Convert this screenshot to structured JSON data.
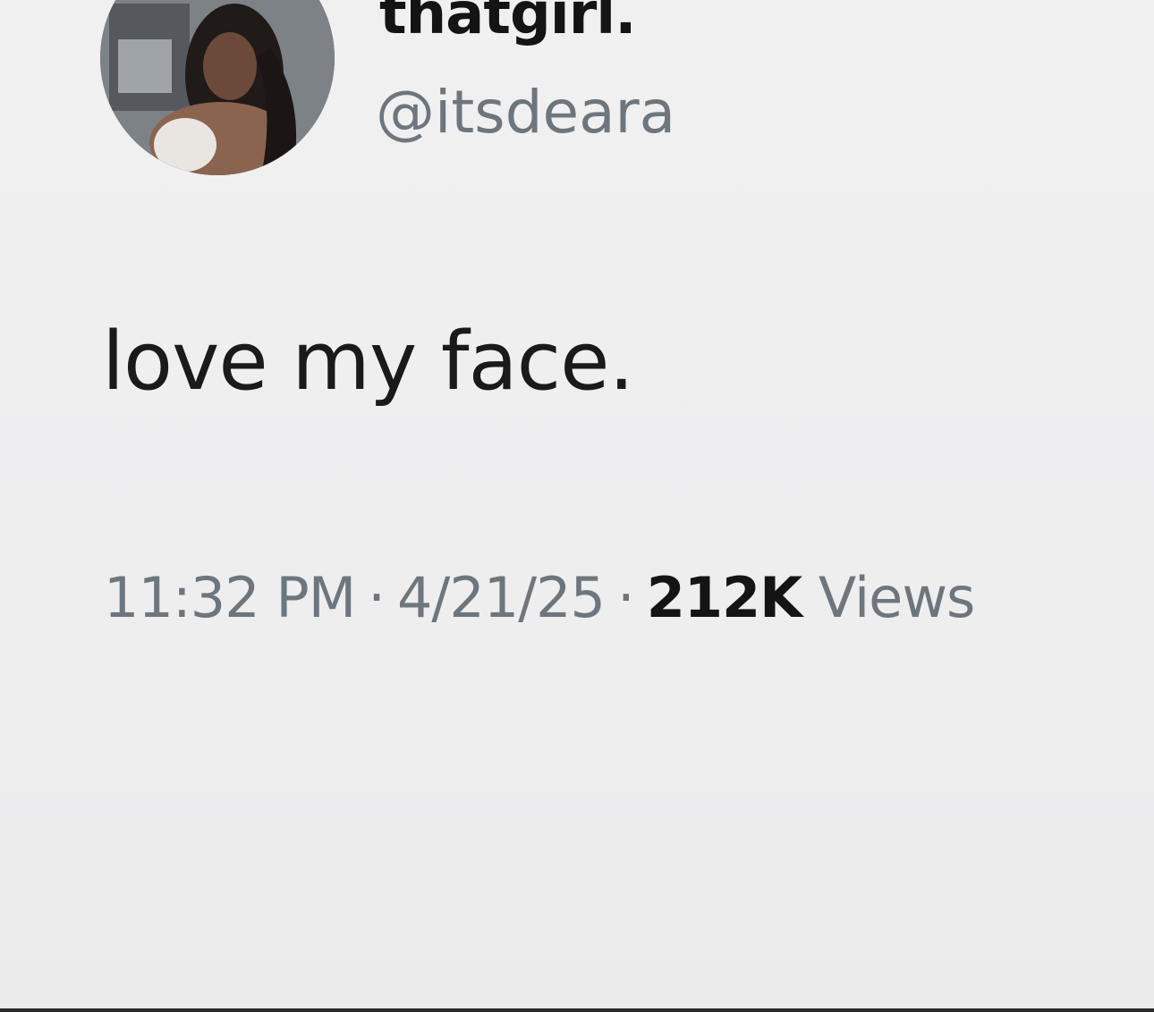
{
  "tweet": {
    "display_name": "thatgirl.",
    "handle": "@itsdeara",
    "text": "love my face.",
    "time": "11:32 PM",
    "date": "4/21/25",
    "separator": "·",
    "views_count": "212K",
    "views_label": "Views"
  },
  "colors": {
    "text_primary": "#141414",
    "text_secondary": "#6e767d",
    "background": "#efeff0"
  },
  "icons": {
    "avatar": "profile-avatar-image"
  }
}
